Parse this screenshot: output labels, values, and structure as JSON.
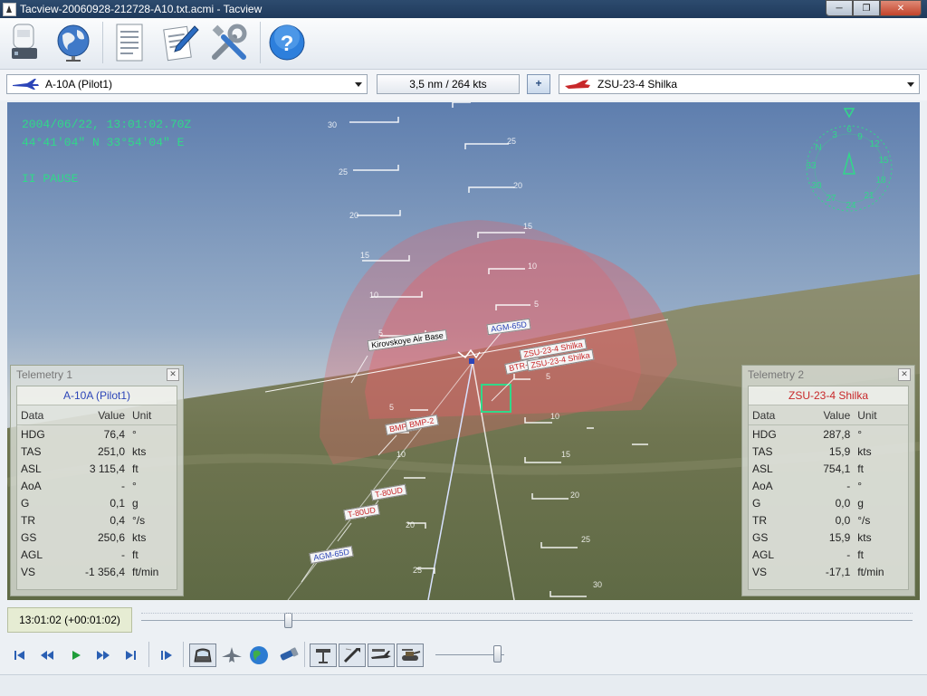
{
  "window": {
    "title": "Tacview-20060928-212728-A10.txt.acmi - Tacview",
    "controls": [
      "minimize",
      "maximize",
      "close"
    ]
  },
  "toolbar": {
    "buttons": [
      {
        "name": "open-flight-icon"
      },
      {
        "name": "globe-icon"
      },
      {
        "name": "document-icon"
      },
      {
        "name": "edit-icon"
      },
      {
        "name": "tools-icon"
      },
      {
        "name": "help-icon",
        "glyph": "?"
      }
    ]
  },
  "selector": {
    "primary_object": "A-10A (Pilot1)",
    "distance_readout": "3,5 nm / 264 kts",
    "add_label": "+",
    "secondary_object": "ZSU-23-4 Shilka"
  },
  "hud": {
    "datetime": "2004/06/22, 13:01:02.70Z",
    "coordinates": "44°41'04\" N  33°54'04\" E",
    "pause_status": "II PAUSE"
  },
  "scene_labels": {
    "airbase": "Kirovskoye Air Base",
    "objects": [
      "AGM-65D",
      "AGM-65D",
      "BTR-70",
      "ZSU-23-4 Shilka",
      "ZSU-23-4 Shilka",
      "BMP-2",
      "BMP-2",
      "T-80UD",
      "T-80UD"
    ]
  },
  "telemetry1": {
    "title": "Telemetry 1",
    "object": "A-10A (Pilot1)",
    "headers": [
      "Data",
      "Value",
      "Unit"
    ],
    "rows": [
      [
        "HDG",
        "76,4",
        "°"
      ],
      [
        "TAS",
        "251,0",
        "kts"
      ],
      [
        "ASL",
        "3 115,4",
        "ft"
      ],
      [
        "AoA",
        "-",
        "°"
      ],
      [
        "G",
        "0,1",
        "g"
      ],
      [
        "TR",
        "0,4",
        "°/s"
      ],
      [
        "GS",
        "250,6",
        "kts"
      ],
      [
        "AGL",
        "-",
        "ft"
      ],
      [
        "VS",
        "-1 356,4",
        "ft/min"
      ]
    ]
  },
  "telemetry2": {
    "title": "Telemetry 2",
    "object": "ZSU-23-4 Shilka",
    "headers": [
      "Data",
      "Value",
      "Unit"
    ],
    "rows": [
      [
        "HDG",
        "287,8",
        "°"
      ],
      [
        "TAS",
        "15,9",
        "kts"
      ],
      [
        "ASL",
        "754,1",
        "ft"
      ],
      [
        "AoA",
        "-",
        "°"
      ],
      [
        "G",
        "0,0",
        "g"
      ],
      [
        "TR",
        "0,0",
        "°/s"
      ],
      [
        "GS",
        "15,9",
        "kts"
      ],
      [
        "AGL",
        "-",
        "ft"
      ],
      [
        "VS",
        "-17,1",
        "ft/min"
      ]
    ]
  },
  "playback": {
    "time_display": "13:01:02 (+00:01:02)",
    "timeline_position": 0.19,
    "speed_level": 0.9
  },
  "colors": {
    "hud_green": "#31d889",
    "object1_blue": "#2c45b8",
    "object2_red": "#c8282a",
    "threat_dome": "#e0626a"
  }
}
